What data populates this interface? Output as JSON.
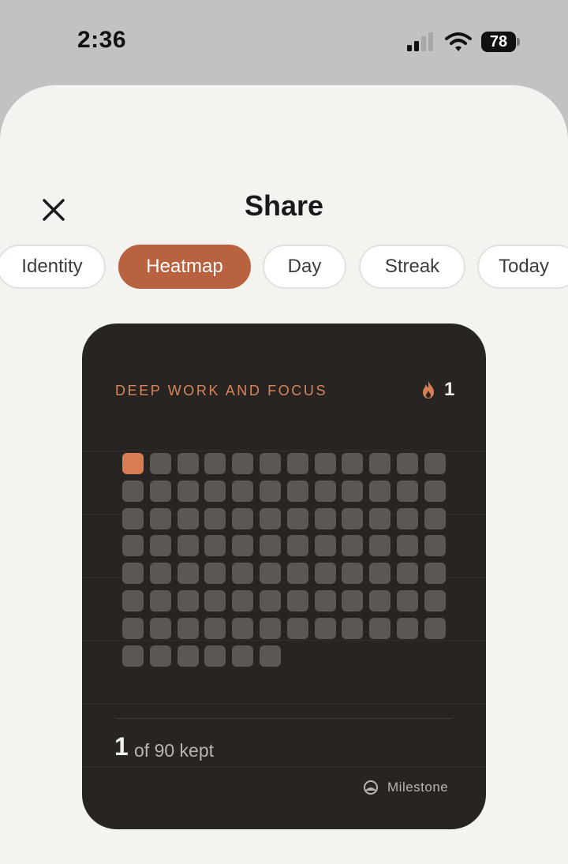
{
  "status_bar": {
    "time": "2:36",
    "battery": "78"
  },
  "header": {
    "title": "Share",
    "close_icon": "close-icon"
  },
  "tabs": [
    {
      "label": "Identity",
      "active": false
    },
    {
      "label": "Heatmap",
      "active": true
    },
    {
      "label": "Day",
      "active": false
    },
    {
      "label": "Streak",
      "active": false
    },
    {
      "label": "Today",
      "active": false
    }
  ],
  "card": {
    "title": "DEEP WORK AND FOCUS",
    "streak_icon": "flame-icon",
    "streak_count": "1",
    "heatmap": {
      "total_days": 90,
      "columns": 12,
      "kept_days": [
        0
      ]
    },
    "kept_count": "1",
    "kept_label": "of 90 kept",
    "brand_icon": "milestone-icon",
    "brand_label": "Milestone"
  },
  "colors": {
    "accent": "#b9623f",
    "kept_cell": "#d97d56",
    "empty_cell": "#5a5754",
    "card_background": "#272421",
    "sheet_background": "#f4f3f0"
  }
}
